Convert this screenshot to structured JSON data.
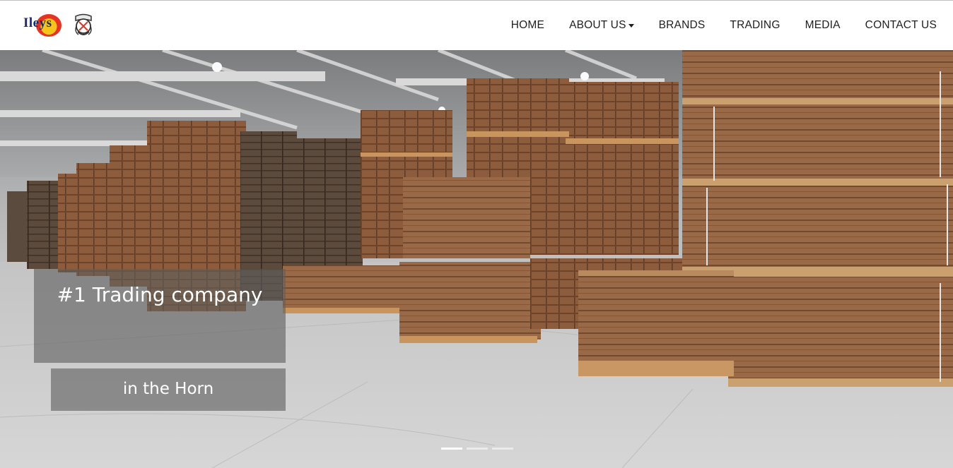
{
  "brand": {
    "logo_text": "Ileys",
    "logo_name": "ileys-logo",
    "emblem_name": "emblem-logo"
  },
  "nav": {
    "items": [
      {
        "label": "HOME",
        "has_dropdown": false
      },
      {
        "label": "ABOUT US",
        "has_dropdown": true
      },
      {
        "label": "BRANDS",
        "has_dropdown": false
      },
      {
        "label": "TRADING",
        "has_dropdown": false
      },
      {
        "label": "MEDIA",
        "has_dropdown": false
      },
      {
        "label": "CONTACT US",
        "has_dropdown": false
      }
    ]
  },
  "hero": {
    "caption_line1": "#1 Trading company",
    "caption_line2": "in the Horn",
    "slides": 3,
    "active_slide": 1
  },
  "colors": {
    "nav_text": "#1f1f1f",
    "caption_bg": "#5f5f5f",
    "wood": "#8a5a3b"
  }
}
